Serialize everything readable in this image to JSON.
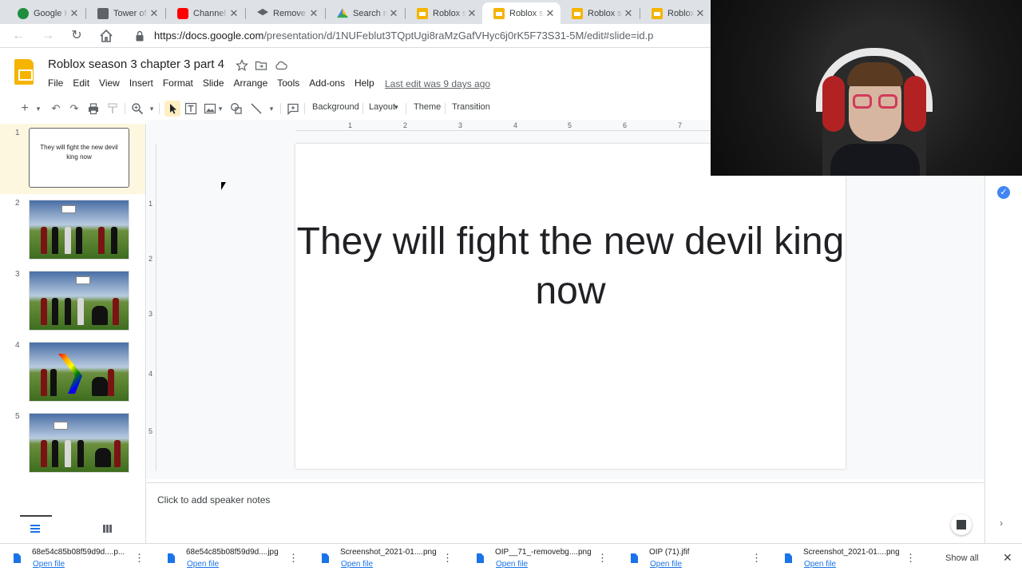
{
  "browser": {
    "tabs": [
      {
        "title": "Google Ha",
        "favicon": "chat-icon"
      },
      {
        "title": "Tower of",
        "favicon": "book-icon"
      },
      {
        "title": "Channel c",
        "favicon": "youtube-icon"
      },
      {
        "title": "Remove B",
        "favicon": "graduation-cap-icon"
      },
      {
        "title": "Search re",
        "favicon": "google-drive-icon"
      },
      {
        "title": "Roblox se",
        "favicon": "slides-icon"
      },
      {
        "title": "Roblox se",
        "favicon": "slides-icon",
        "active": true
      },
      {
        "title": "Roblox se",
        "favicon": "slides-icon"
      },
      {
        "title": "Roblox se",
        "favicon": "slides-icon"
      }
    ],
    "close_glyph": "✕",
    "url_host": "https://docs.google.com",
    "url_path": "/presentation/d/1NUFeblut3TQptUgi8raMzGafVHyc6j0rK5F73S31-5M/edit#slide=id.p"
  },
  "doc": {
    "title": "Roblox season 3 chapter 3 part 4",
    "menu": [
      "File",
      "Edit",
      "View",
      "Insert",
      "Format",
      "Slide",
      "Arrange",
      "Tools",
      "Add-ons",
      "Help"
    ],
    "last_edit": "Last edit was 9 days ago"
  },
  "toolbar": {
    "background_label": "Background",
    "layout_label": "Layout",
    "layout_caret": "▾",
    "theme_label": "Theme",
    "transition_label": "Transition"
  },
  "ruler": {
    "h_numbers": [
      "1",
      "2",
      "3",
      "4",
      "5",
      "6",
      "7"
    ],
    "v_numbers": [
      "1",
      "2",
      "3",
      "4",
      "5"
    ]
  },
  "filmstrip": {
    "slides": [
      {
        "number": "1",
        "text": "They will fight the new devil king now"
      },
      {
        "number": "2"
      },
      {
        "number": "3"
      },
      {
        "number": "4"
      },
      {
        "number": "5"
      }
    ]
  },
  "slide": {
    "title": "They will fight the new devil king now"
  },
  "notes": {
    "placeholder": "Click to add speaker notes"
  },
  "downloads": {
    "items": [
      {
        "name": "68e54c85b08f59d9d....p...",
        "action": "Open file"
      },
      {
        "name": "68e54c85b08f59d9d....jpg",
        "action": "Open file"
      },
      {
        "name": "Screenshot_2021-01....png",
        "action": "Open file"
      },
      {
        "name": "OIP__71_-removebg....png",
        "action": "Open file"
      },
      {
        "name": "OIP (71).jfif",
        "action": "Open file"
      },
      {
        "name": "Screenshot_2021-01....png",
        "action": "Open file"
      }
    ],
    "more_glyph": "⋮",
    "show_all": "Show all",
    "close_glyph": "✕"
  },
  "colors": {
    "accent_blue": "#1a73e8",
    "slides_yellow": "#f4b400",
    "selected_slide_bg": "#fef7e0"
  }
}
